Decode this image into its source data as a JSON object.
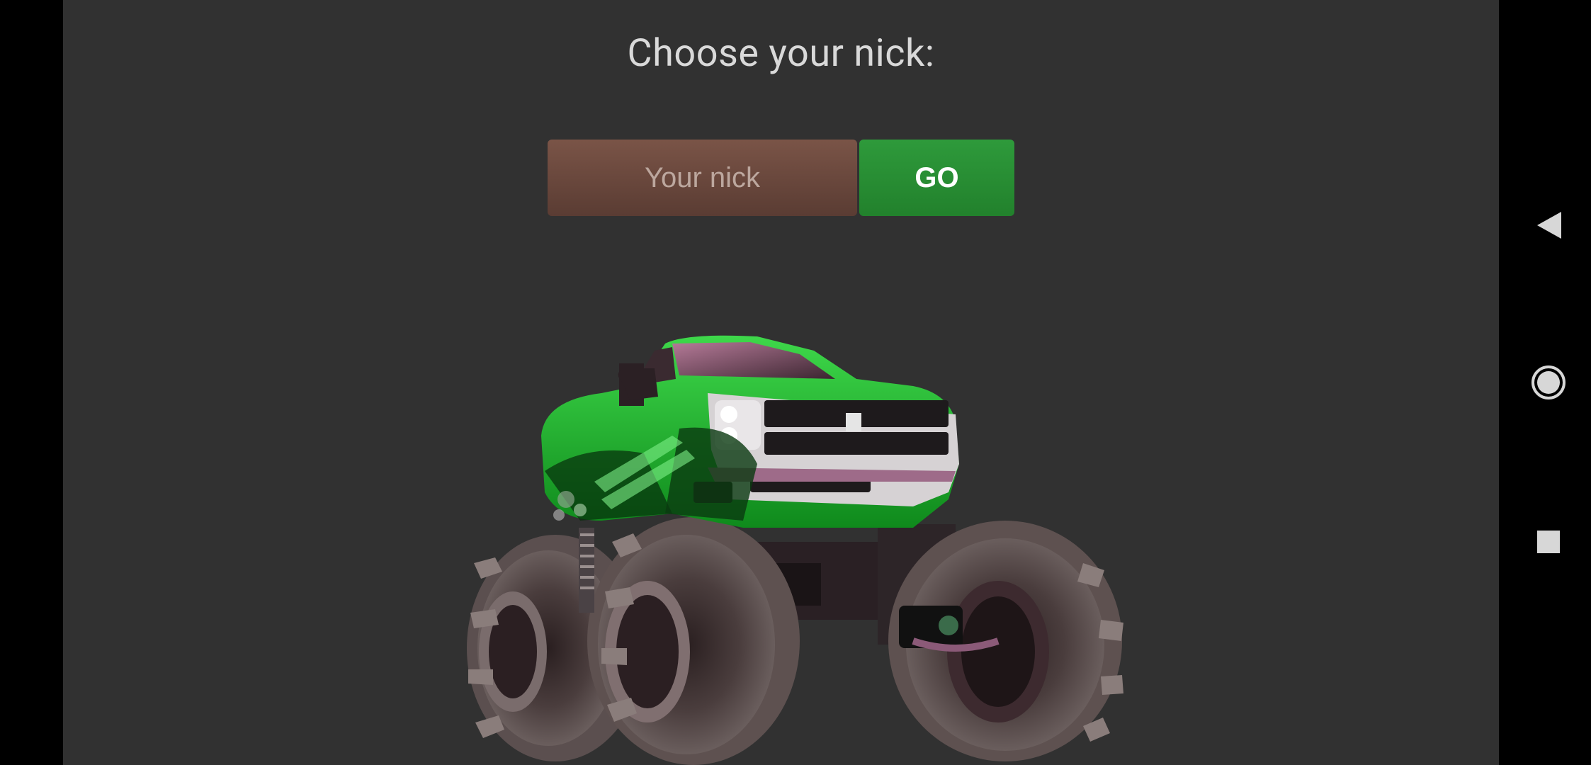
{
  "screen": {
    "title": "Choose your nick:",
    "nick_input": {
      "placeholder": "Your nick",
      "value": ""
    },
    "go_button": {
      "label": "GO"
    }
  },
  "illustration": {
    "icon": "monster-truck-illustration"
  },
  "android_nav": {
    "back": "back-icon",
    "home": "home-icon",
    "recents": "recents-icon"
  },
  "colors": {
    "background": "#313131",
    "input_brown": "#6b4a40",
    "go_green": "#2a8f36",
    "truck_green": "#1db32a"
  }
}
